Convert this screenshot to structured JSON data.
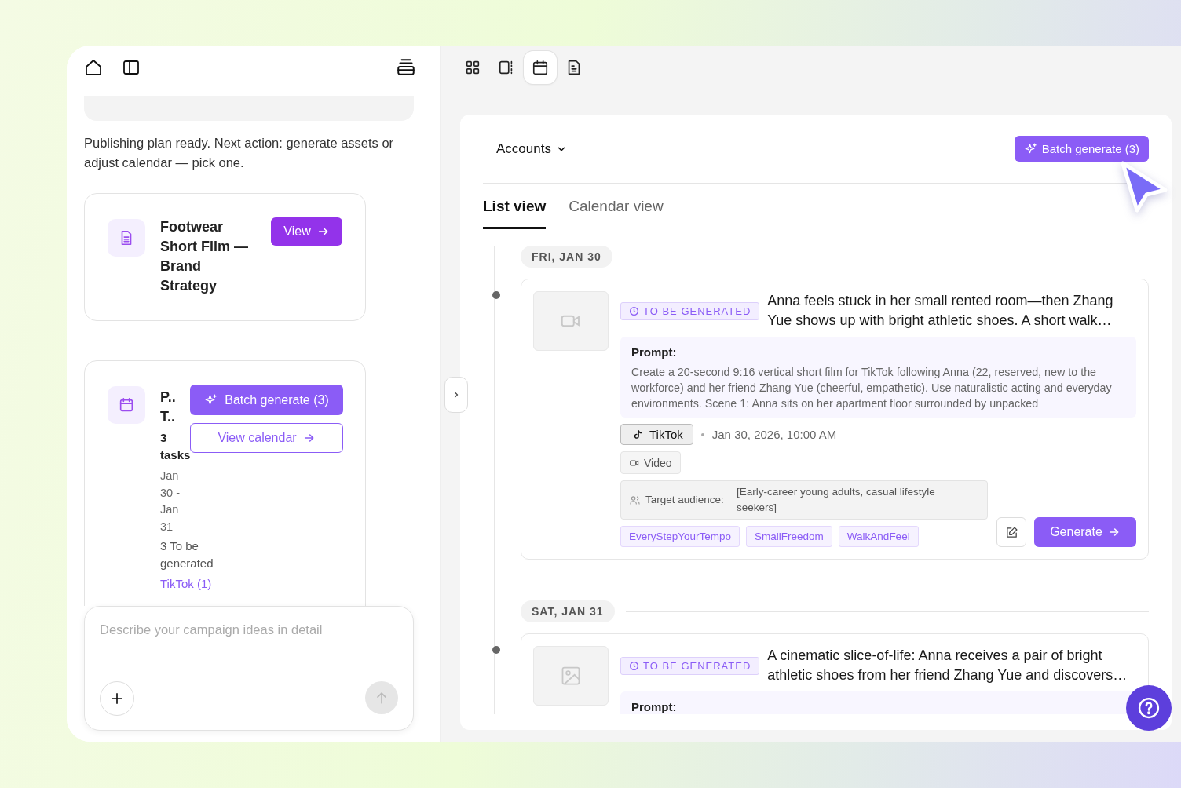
{
  "chat": {
    "message": "Publishing plan ready. Next action: generate assets or adjust calendar — pick one.",
    "cards": [
      {
        "kind": "document",
        "title": "Footwear Short Film — Brand Strategy",
        "buttons": [
          {
            "label": "View",
            "kind": "solid"
          }
        ]
      },
      {
        "kind": "calendar",
        "title": "P.. T..",
        "tasks": "3 tasks",
        "date_range": "Jan 30 - Jan 31",
        "status": "3 To be generated",
        "platform": "TikTok (1)",
        "buttons": [
          {
            "label": "Batch generate (3)",
            "kind": "sparkle"
          },
          {
            "label": "View calendar",
            "kind": "outline"
          }
        ]
      }
    ]
  },
  "composer": {
    "placeholder": "Describe your campaign ideas in detail"
  },
  "view_switcher": [
    {
      "kind": "grid",
      "selected": false
    },
    {
      "kind": "split",
      "selected": false
    },
    {
      "kind": "calendar",
      "selected": true
    },
    {
      "kind": "document",
      "selected": false
    }
  ],
  "panel": {
    "accounts_label": "Accounts",
    "batch_button": "Batch generate (3)",
    "tabs": [
      {
        "label": "List view",
        "selected": true
      },
      {
        "label": "Calendar view",
        "selected": false
      }
    ],
    "days": [
      {
        "date": "FRI, JAN 30",
        "posts": [
          {
            "kind": "video",
            "status": "TO BE GENERATED",
            "title": "Anna feels stuck in her small rented room—then Zhang Yue shows up with bright athletic shoes. A short walk…",
            "prompt_label": "Prompt:",
            "prompt": "Create a 20-second 9:16 vertical short film for TikTok following Anna (22, reserved, new to the workforce) and her friend Zhang Yue (cheerful, empathetic). Use naturalistic acting and everyday environments. Scene 1: Anna sits on her apartment floor surrounded by unpacked",
            "platform": "TikTok",
            "scheduled": "Jan 30, 2026, 10:00 AM",
            "format": "Video",
            "audience_label": "Target audience:",
            "audience": "[Early-career young adults, casual lifestyle seekers]",
            "tags": [
              "EveryStepYourTempo",
              "SmallFreedom",
              "WalkAndFeel"
            ],
            "generate_button": "Generate"
          }
        ]
      },
      {
        "date": "SAT, JAN 31",
        "posts": [
          {
            "kind": "image",
            "status": "TO BE GENERATED",
            "title": "A cinematic slice-of-life: Anna receives a pair of bright athletic shoes from her friend Zhang Yue and discovers…",
            "prompt_label": "Prompt:"
          }
        ]
      }
    ]
  }
}
